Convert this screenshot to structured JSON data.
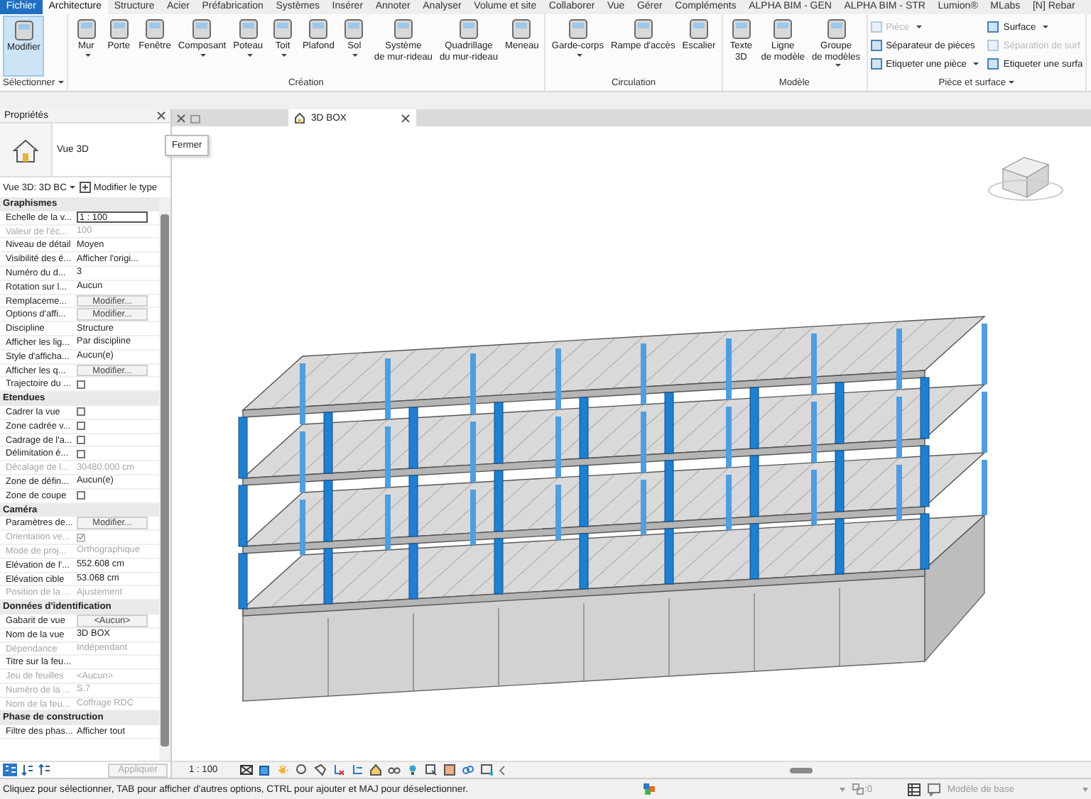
{
  "menu_tabs": [
    {
      "label": "Fichier",
      "kind": "file",
      "selected": false
    },
    {
      "label": "Architecture",
      "kind": "tab",
      "selected": true
    },
    {
      "label": "Structure",
      "kind": "tab",
      "selected": false
    },
    {
      "label": "Acier",
      "kind": "tab",
      "selected": false
    },
    {
      "label": "Préfabrication",
      "kind": "tab",
      "selected": false
    },
    {
      "label": "Systèmes",
      "kind": "tab",
      "selected": false
    },
    {
      "label": "Insérer",
      "kind": "tab",
      "selected": false
    },
    {
      "label": "Annoter",
      "kind": "tab",
      "selected": false
    },
    {
      "label": "Analyser",
      "kind": "tab",
      "selected": false
    },
    {
      "label": "Volume et site",
      "kind": "tab",
      "selected": false
    },
    {
      "label": "Collaborer",
      "kind": "tab",
      "selected": false
    },
    {
      "label": "Vue",
      "kind": "tab",
      "selected": false
    },
    {
      "label": "Gérer",
      "kind": "tab",
      "selected": false
    },
    {
      "label": "Compléments",
      "kind": "tab",
      "selected": false
    },
    {
      "label": "ALPHA BIM - GEN",
      "kind": "tab",
      "selected": false
    },
    {
      "label": "ALPHA BIM - STR",
      "kind": "tab",
      "selected": false
    },
    {
      "label": "Lumion®",
      "kind": "tab",
      "selected": false
    },
    {
      "label": "MLabs",
      "kind": "tab",
      "selected": false
    },
    {
      "label": "[N] Rebar",
      "kind": "tab",
      "selected": false
    }
  ],
  "ribbon_groups": [
    {
      "title": "Sélectionner",
      "has_menu": true,
      "kind": "large",
      "tools": [
        {
          "label": "Modifier",
          "selected": true,
          "has_menu": false
        }
      ]
    },
    {
      "title": "Création",
      "has_menu": false,
      "kind": "large",
      "tools": [
        {
          "label": "Mur",
          "selected": false,
          "has_menu": true
        },
        {
          "label": "Porte",
          "selected": false,
          "has_menu": false
        },
        {
          "label": "Fenêtre",
          "selected": false,
          "has_menu": false
        },
        {
          "label": "Composant",
          "selected": false,
          "has_menu": true
        },
        {
          "label": "Poteau",
          "selected": false,
          "has_menu": true
        },
        {
          "label": "Toit",
          "selected": false,
          "has_menu": true
        },
        {
          "label": "Plafond",
          "selected": false,
          "has_menu": false
        },
        {
          "label": "Sol",
          "selected": false,
          "has_menu": true
        },
        {
          "label": "Système\nde mur-rideau",
          "selected": false,
          "has_menu": false
        },
        {
          "label": "Quadrillage\ndu mur-rideau",
          "selected": false,
          "has_menu": false
        },
        {
          "label": "Meneau",
          "selected": false,
          "has_menu": false
        }
      ]
    },
    {
      "title": "Circulation",
      "has_menu": false,
      "kind": "large",
      "tools": [
        {
          "label": "Garde-corps",
          "selected": false,
          "has_menu": true
        },
        {
          "label": "Rampe d'accès",
          "selected": false,
          "has_menu": false
        },
        {
          "label": "Escalier",
          "selected": false,
          "has_menu": false
        }
      ]
    },
    {
      "title": "Modèle",
      "has_menu": false,
      "kind": "large",
      "tools": [
        {
          "label": "Texte\n3D",
          "selected": false,
          "has_menu": false
        },
        {
          "label": "Ligne\nde modèle",
          "selected": false,
          "has_menu": false
        },
        {
          "label": "Groupe\nde modèles",
          "selected": false,
          "has_menu": true
        }
      ]
    },
    {
      "title": "Pièce et surface",
      "has_menu": true,
      "kind": "small",
      "tools": [
        {
          "label": "Pièce",
          "disabled": true,
          "has_menu": true
        },
        {
          "label": "Séparateur de pièces",
          "disabled": false,
          "has_menu": false
        },
        {
          "label": "Etiqueter une pièce",
          "disabled": false,
          "has_menu": true
        },
        {
          "label": "Surface",
          "disabled": false,
          "has_menu": true
        },
        {
          "label": "Séparation de surf",
          "disabled": true,
          "has_menu": false
        },
        {
          "label": "Etiqueter une surfa",
          "disabled": false,
          "has_menu": false
        }
      ]
    }
  ],
  "properties": {
    "title": "Propriétés",
    "type_name": "Vue 3D",
    "tooltip": "Fermer",
    "instance_selector": "Vue 3D: 3D BC",
    "edit_type_button": "Modifier le type",
    "sections": [
      {
        "title": "Graphismes",
        "rows": [
          {
            "label": "Echelle de la v...",
            "kind": "input",
            "value": "1 : 100",
            "disabled": false
          },
          {
            "label": "Valeur de l'éc...",
            "kind": "text",
            "value": "100",
            "disabled": true
          },
          {
            "label": "Niveau de détail",
            "kind": "text",
            "value": "Moyen",
            "disabled": false
          },
          {
            "label": "Visibilité des é...",
            "kind": "text",
            "value": "Afficher l'origi...",
            "disabled": false
          },
          {
            "label": "Numéro du d...",
            "kind": "text",
            "value": "3",
            "disabled": false
          },
          {
            "label": "Rotation sur l...",
            "kind": "text",
            "value": "Aucun",
            "disabled": false
          },
          {
            "label": "Remplaceme...",
            "kind": "button",
            "value": "Modifier...",
            "disabled": false
          },
          {
            "label": "Options d'affi...",
            "kind": "button",
            "value": "Modifier...",
            "disabled": false
          },
          {
            "label": "Discipline",
            "kind": "text",
            "value": "Structure",
            "disabled": false
          },
          {
            "label": "Afficher les lig...",
            "kind": "text",
            "value": "Par discipline",
            "disabled": false
          },
          {
            "label": "Style d'afficha...",
            "kind": "text",
            "value": "Aucun(e)",
            "disabled": false
          },
          {
            "label": "Afficher les q...",
            "kind": "button",
            "value": "Modifier...",
            "disabled": false
          },
          {
            "label": "Trajectoire du ...",
            "kind": "checkbox",
            "checked": false,
            "disabled": false
          }
        ]
      },
      {
        "title": "Etendues",
        "rows": [
          {
            "label": "Cadrer la vue",
            "kind": "checkbox",
            "checked": false,
            "disabled": false
          },
          {
            "label": "Zone cadrée v...",
            "kind": "checkbox",
            "checked": false,
            "disabled": false
          },
          {
            "label": "Cadrage de l'a...",
            "kind": "checkbox",
            "checked": false,
            "disabled": false
          },
          {
            "label": "Délimitation é...",
            "kind": "checkbox",
            "checked": false,
            "disabled": false
          },
          {
            "label": "Décalage de l...",
            "kind": "text",
            "value": "30480.000 cm",
            "disabled": true
          },
          {
            "label": "Zone de défin...",
            "kind": "text",
            "value": "Aucun(e)",
            "disabled": false
          },
          {
            "label": "Zone de coupe",
            "kind": "checkbox",
            "checked": false,
            "disabled": false
          }
        ]
      },
      {
        "title": "Caméra",
        "rows": [
          {
            "label": "Paramètres de...",
            "kind": "button",
            "value": "Modifier...",
            "disabled": false
          },
          {
            "label": "Orientation ve...",
            "kind": "checkbox",
            "checked": true,
            "disabled": true
          },
          {
            "label": "Mode de proj...",
            "kind": "text",
            "value": "Orthographique",
            "disabled": true
          },
          {
            "label": "Elévation de l'...",
            "kind": "text",
            "value": "552.608 cm",
            "disabled": false
          },
          {
            "label": "Elévation cible",
            "kind": "text",
            "value": "53.068 cm",
            "disabled": false
          },
          {
            "label": "Position de la ...",
            "kind": "text",
            "value": "Ajustement",
            "disabled": true
          }
        ]
      },
      {
        "title": "Données d'identification",
        "rows": [
          {
            "label": "Gabarit de vue",
            "kind": "button",
            "value": "<Aucun>",
            "disabled": false
          },
          {
            "label": "Nom de la vue",
            "kind": "text",
            "value": "3D BOX",
            "disabled": false
          },
          {
            "label": "Dépendance",
            "kind": "text",
            "value": "Indépendant",
            "disabled": true
          },
          {
            "label": "Titre sur la feu...",
            "kind": "text",
            "disabled": false
          },
          {
            "label": "Jeu de feuilles",
            "kind": "text",
            "value": "<Aucun>",
            "disabled": true
          },
          {
            "label": "Numéro de la ...",
            "kind": "text",
            "value": "S.7",
            "disabled": true
          },
          {
            "label": "Nom de la feu...",
            "kind": "text",
            "value": "Coffrage RDC",
            "disabled": true
          }
        ]
      },
      {
        "title": "Phase de construction",
        "rows": [
          {
            "label": "Filtre des phas...",
            "kind": "text",
            "value": "Afficher tout",
            "disabled": false
          }
        ]
      }
    ],
    "apply_button": {
      "label": "Appliquer",
      "disabled": true
    }
  },
  "view_tab": {
    "title": "3D BOX",
    "selected": true
  },
  "view_bar": {
    "scale": "1 : 100"
  },
  "status_bar": {
    "message": "Cliquez pour sélectionner, TAB pour afficher d'autres options,  CTRL pour ajouter et MAJ pour déselectionner.",
    "count": ":0",
    "model": "Modèle de base"
  }
}
